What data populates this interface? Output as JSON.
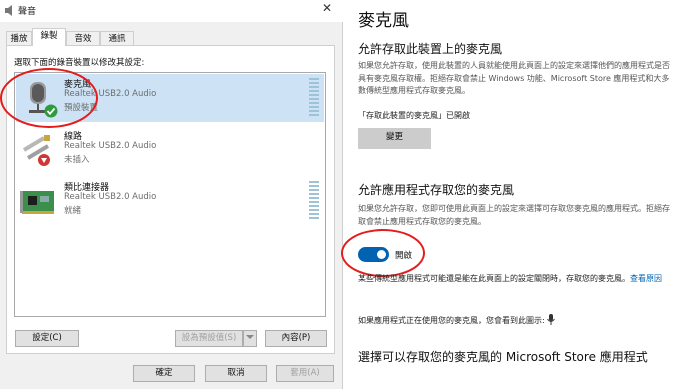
{
  "dialog": {
    "title": "聲音",
    "close_glyph": "✕",
    "tabs": [
      {
        "label": "播放"
      },
      {
        "label": "錄製"
      },
      {
        "label": "音效"
      },
      {
        "label": "通訊"
      }
    ],
    "instruction": "選取下面的錄音裝置以修改其設定:",
    "devices": [
      {
        "name": "麥克風",
        "driver": "Realtek USB2.0 Audio",
        "status": "預設裝置",
        "icon": "microphone-icon"
      },
      {
        "name": "線路",
        "driver": "Realtek USB2.0 Audio",
        "status": "未插入",
        "icon": "line-in-plug-icon"
      },
      {
        "name": "類比連接器",
        "driver": "Realtek USB2.0 Audio",
        "status": "就緒",
        "icon": "sound-card-icon"
      }
    ],
    "buttons": {
      "configure": "設定(C)",
      "set_default": "設為預設值(S)",
      "properties": "內容(P)",
      "ok": "確定",
      "cancel": "取消",
      "apply": "套用(A)"
    }
  },
  "settings": {
    "page_title": "麥克風",
    "section1": {
      "heading": "允許存取此裝置上的麥克風",
      "desc": "如果您允許存取，使用此裝置的人員就能使用此頁面上的設定來選擇他們的應用程式是否具有麥克風存取權。拒絕存取會禁止 Windows 功能、Microsoft Store 應用程式和大多數傳統型應用程式存取麥克風。",
      "status": "「存取此裝置的麥克風」已開啟",
      "change_button": "變更"
    },
    "section2": {
      "heading": "允許應用程式存取您的麥克風",
      "desc": "如果您允許存取，您即可使用此頁面上的設定來選擇可存取您麥克風的應用程式。拒絕存取會禁止應用程式存取您的麥克風。",
      "toggle_label": "開啟",
      "toggle_on": true,
      "note_text": "某些傳統型應用程式可能還是能在此頁面上的設定關閉時，存取您的麥克風。",
      "note_link": "查看原因",
      "in_use_text": "如果應用程式正在使用您的麥克風，您會看到此圖示:"
    },
    "section3": {
      "heading": "選擇可以存取您的麥克風的 Microsoft Store 應用程式"
    }
  },
  "colors": {
    "accent": "#0063b1",
    "highlight_circle": "#e51c1c",
    "selected_row": "#cde3f5",
    "default_check": "#2e9b3f"
  }
}
